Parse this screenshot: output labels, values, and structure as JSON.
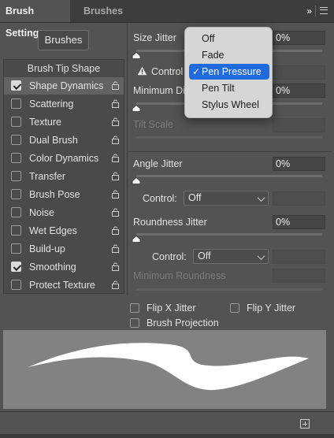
{
  "tabs": {
    "active": "Brush Settings",
    "inactive": "Brushes",
    "collapse": "»",
    "menu_icon": "menu-icon"
  },
  "brushes_button": "Brushes",
  "list": {
    "header": "Brush Tip Shape",
    "items": [
      {
        "label": "Shape Dynamics",
        "checked": true,
        "selected": true
      },
      {
        "label": "Scattering",
        "checked": false
      },
      {
        "label": "Texture",
        "checked": false
      },
      {
        "label": "Dual Brush",
        "checked": false
      },
      {
        "label": "Color Dynamics",
        "checked": false
      },
      {
        "label": "Transfer",
        "checked": false
      },
      {
        "label": "Brush Pose",
        "checked": false
      },
      {
        "label": "Noise",
        "checked": false
      },
      {
        "label": "Wet Edges",
        "checked": false
      },
      {
        "label": "Build-up",
        "checked": false
      },
      {
        "label": "Smoothing",
        "checked": true
      },
      {
        "label": "Protect Texture",
        "checked": false
      }
    ]
  },
  "settings": {
    "size_jitter": {
      "label": "Size Jitter",
      "value": "0%",
      "slider": 0
    },
    "size_control": {
      "label": "Control",
      "icon": "warning-icon"
    },
    "minimum_diameter": {
      "label": "Minimum Di",
      "value": "0%",
      "slider": 0
    },
    "tilt_scale": {
      "label": "Tilt Scale"
    },
    "angle_jitter": {
      "label": "Angle Jitter",
      "value": "0%",
      "slider": 0
    },
    "angle_control": {
      "label": "Control:",
      "value": "Off"
    },
    "roundness_jitter": {
      "label": "Roundness Jitter",
      "value": "0%",
      "slider": 0
    },
    "roundness_control": {
      "label": "Control:",
      "value": "Off"
    },
    "minimum_roundness": {
      "label": "Minimum Roundness"
    }
  },
  "options": {
    "flip_x": {
      "label": "Flip X Jitter",
      "checked": false
    },
    "flip_y": {
      "label": "Flip Y Jitter",
      "checked": false
    },
    "brush_projection": {
      "label": "Brush Projection",
      "checked": false
    }
  },
  "dropdown": {
    "options": [
      "Off",
      "Fade",
      "Pen Pressure",
      "Pen Tilt",
      "Stylus Wheel"
    ],
    "selected": "Pen Pressure",
    "check": "✓"
  },
  "colors": {
    "panel": "#535353",
    "accent": "#1f6bde",
    "preview_bg": "#828282",
    "stroke": "#ffffff"
  }
}
